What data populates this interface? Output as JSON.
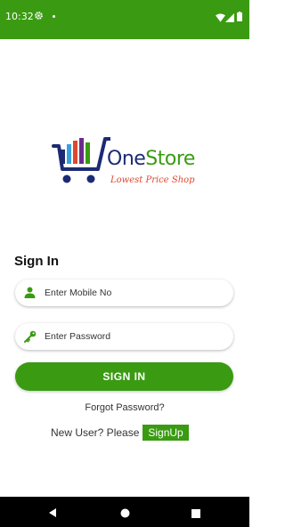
{
  "status_bar": {
    "time": "10:32",
    "icons": [
      "gear-icon",
      "dot-icon",
      "wifi-icon",
      "signal-icon",
      "battery-icon"
    ]
  },
  "colors": {
    "brand_green": "#3a9b12",
    "brand_navy": "#1c2a74",
    "tagline_red": "#e0472e"
  },
  "logo": {
    "name_part1": "One",
    "name_part2": "Store",
    "tagline": "Lowest Price Shop"
  },
  "signin": {
    "title": "Sign In",
    "mobile_placeholder": "Enter Mobile No",
    "mobile_value": "",
    "password_placeholder": "Enter Password",
    "password_value": "",
    "button_label": "SIGN IN",
    "forgot_label": "Forgot Password?",
    "new_user_prompt": "New User? Please",
    "signup_label": "SignUp"
  },
  "nav_bar": {
    "icons": [
      "back-icon",
      "home-icon",
      "recents-icon"
    ]
  }
}
